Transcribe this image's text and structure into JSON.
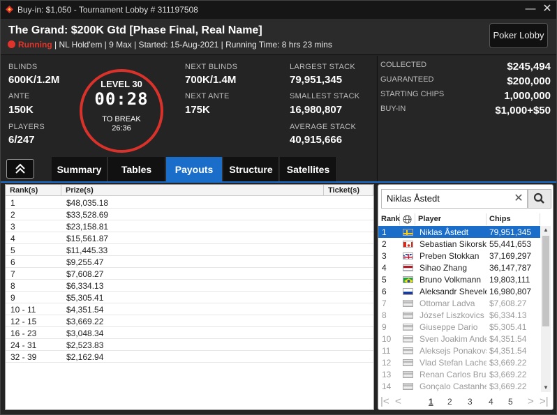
{
  "titlebar": {
    "text": "Buy-in: $1,050 - Tournament Lobby # 311197508",
    "minimize": "—",
    "close": "✕"
  },
  "header": {
    "name": "The Grand: $200K Gtd [Phase Final, Real Name]",
    "status": "Running",
    "details": " | NL Hold'em | 9 Max | Started: 15-Aug-2021 | Running Time: 8 hrs  23 mins",
    "lobby_button": "Poker Lobby"
  },
  "stats": {
    "blinds_label": "BLINDS",
    "blinds": "600K/1.2M",
    "ante_label": "ANTE",
    "ante": "150K",
    "players_label": "PLAYERS",
    "players": "6/247",
    "next_blinds_label": "NEXT BLINDS",
    "next_blinds": "700K/1.4M",
    "next_ante_label": "NEXT ANTE",
    "next_ante": "175K",
    "largest_label": "LARGEST STACK",
    "largest": "79,951,345",
    "smallest_label": "SMALLEST STACK",
    "smallest": "16,980,807",
    "average_label": "AVERAGE STACK",
    "average": "40,915,666"
  },
  "clock": {
    "level": "LEVEL 30",
    "time": "00:28",
    "to_break_label": "TO BREAK",
    "to_break": "26:36"
  },
  "prize": {
    "collected_label": "COLLECTED",
    "collected": "$245,494",
    "guaranteed_label": "GUARANTEED",
    "guaranteed": "$200,000",
    "starting_label": "STARTING CHIPS",
    "starting": "1,000,000",
    "buyin_label": "BUY-IN",
    "buyin": "$1,000+$50"
  },
  "tabs": [
    "Summary",
    "Tables",
    "Payouts",
    "Structure",
    "Satellites"
  ],
  "active_tab": "Payouts",
  "payouts": {
    "headers": [
      "Rank(s)",
      "Prize(s)",
      "Ticket(s)"
    ],
    "rows": [
      [
        "1",
        "$48,035.18"
      ],
      [
        "2",
        "$33,528.69"
      ],
      [
        "3",
        "$23,158.81"
      ],
      [
        "4",
        "$15,561.87"
      ],
      [
        "5",
        "$11,445.33"
      ],
      [
        "6",
        "$9,255.47"
      ],
      [
        "7",
        "$7,608.27"
      ],
      [
        "8",
        "$6,334.13"
      ],
      [
        "9",
        "$5,305.41"
      ],
      [
        "10 - 11",
        "$4,351.54"
      ],
      [
        "12 - 15",
        "$3,669.22"
      ],
      [
        "16 - 23",
        "$3,048.34"
      ],
      [
        "24 - 31",
        "$2,523.83"
      ],
      [
        "32 - 39",
        "$2,162.94"
      ]
    ]
  },
  "players_panel": {
    "search_value": "Niklas Åstedt",
    "headers": [
      "Rank",
      "Player",
      "Chips"
    ],
    "rows": [
      {
        "rank": "1",
        "flag": "se",
        "name": "Niklas Åstedt",
        "chips": "79,951,345",
        "state": "selected"
      },
      {
        "rank": "2",
        "flag": "ca",
        "name": "Sebastian Sikorski",
        "chips": "55,441,653",
        "state": "active"
      },
      {
        "rank": "3",
        "flag": "gb",
        "name": "Preben Stokkan",
        "chips": "37,169,297",
        "state": "active"
      },
      {
        "rank": "4",
        "flag": "nl",
        "name": "Sihao Zhang",
        "chips": "36,147,787",
        "state": "active"
      },
      {
        "rank": "5",
        "flag": "br",
        "name": "Bruno Volkmann",
        "chips": "19,803,111",
        "state": "active"
      },
      {
        "rank": "6",
        "flag": "ru",
        "name": "Aleksandr Shevelev",
        "chips": "16,980,807",
        "state": "active"
      },
      {
        "rank": "7",
        "flag": "gray",
        "name": "Ottomar Ladva",
        "chips": "$7,608.27",
        "state": "out"
      },
      {
        "rank": "8",
        "flag": "gray",
        "name": "József Liszkovics",
        "chips": "$6,334.13",
        "state": "out"
      },
      {
        "rank": "9",
        "flag": "gray",
        "name": "Giuseppe Dario",
        "chips": "$5,305.41",
        "state": "out"
      },
      {
        "rank": "10",
        "flag": "gray",
        "name": "Sven Joakim Andersson",
        "chips": "$4,351.54",
        "state": "out"
      },
      {
        "rank": "11",
        "flag": "gray",
        "name": "Aleksejs Ponakovs",
        "chips": "$4,351.54",
        "state": "out"
      },
      {
        "rank": "12",
        "flag": "gray",
        "name": "Vlad Stefan Lache",
        "chips": "$3,669.22",
        "state": "out"
      },
      {
        "rank": "13",
        "flag": "gray",
        "name": "Renan Carlos Bruschi",
        "chips": "$3,669.22",
        "state": "out"
      },
      {
        "rank": "14",
        "flag": "gray",
        "name": "Gonçalo Castanheira",
        "chips": "$3,669.22",
        "state": "out"
      }
    ],
    "pages": [
      "1",
      "2",
      "3",
      "4",
      "5"
    ],
    "current_page": "1"
  },
  "colors": {
    "accent": "#1a6ec9",
    "status_red": "#e0332b"
  }
}
